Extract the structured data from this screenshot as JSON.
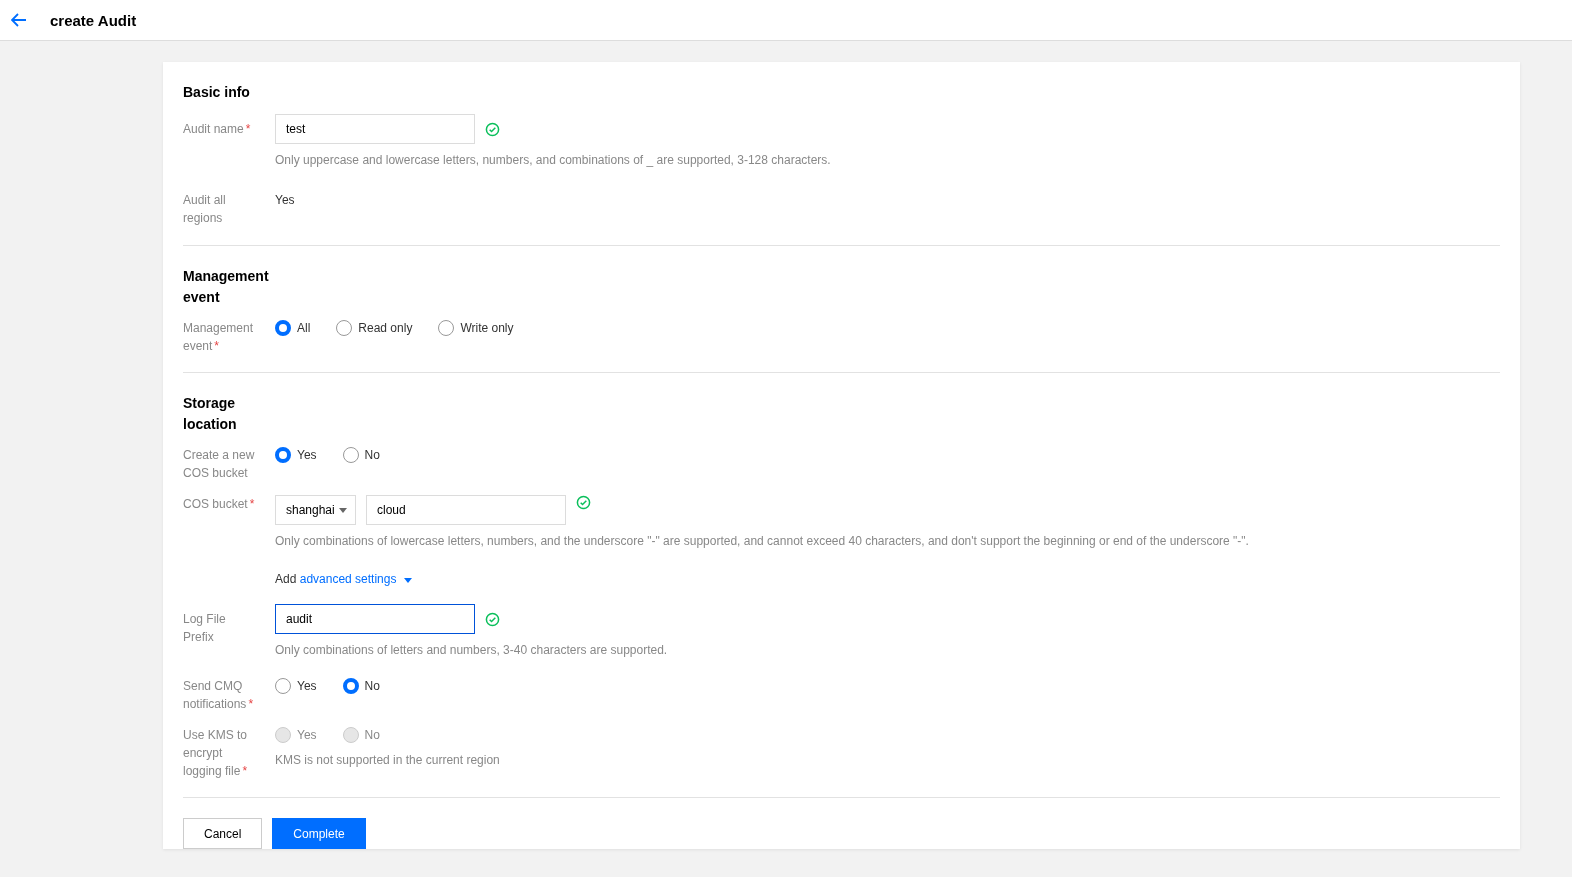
{
  "header": {
    "title": "create Audit"
  },
  "sections": [
    {
      "title": "Basic info",
      "rows": [
        {
          "kind": "input",
          "label": "Audit name",
          "required_mark": "*",
          "value": "test",
          "valid": true,
          "focused": false,
          "hint": "Only uppercase and lowercase letters, numbers, and combinations of _ are supported, 3-128 characters."
        },
        {
          "kind": "text",
          "label": "Audit all regions",
          "value": "Yes"
        }
      ]
    },
    {
      "title": "Management event",
      "rows": [
        {
          "kind": "radio",
          "label": "Management event",
          "required_mark": "*",
          "disabled": false,
          "options": [
            {
              "label": "All",
              "selected": true
            },
            {
              "label": "Read only",
              "selected": false
            },
            {
              "label": "Write only",
              "selected": false
            }
          ]
        }
      ]
    },
    {
      "title": "Storage location",
      "rows": [
        {
          "kind": "radio",
          "label": "Create a new COS bucket",
          "disabled": false,
          "options": [
            {
              "label": "Yes",
              "selected": true
            },
            {
              "label": "No",
              "selected": false
            }
          ]
        },
        {
          "kind": "bucket",
          "label": "COS bucket",
          "required_mark": "*",
          "region": "shanghai",
          "value": "cloud",
          "valid": true,
          "hint": "Only combinations of lowercase letters, numbers, and the underscore \"-\" are supported, and cannot exceed 40 characters, and don't support the beginning or end of the underscore \"-\"."
        },
        {
          "kind": "link",
          "prefix": "Add",
          "link": "advanced settings"
        },
        {
          "kind": "input",
          "label": "Log File Prefix",
          "value": "audit",
          "valid": true,
          "focused": true,
          "hint": "Only combinations of letters and numbers, 3-40 characters are supported."
        },
        {
          "kind": "radio",
          "label": "Send CMQ notifications",
          "required_mark": "*",
          "disabled": false,
          "options": [
            {
              "label": "Yes",
              "selected": false
            },
            {
              "label": "No",
              "selected": true
            }
          ]
        },
        {
          "kind": "radio",
          "label": "Use KMS to encrypt logging file",
          "required_mark": "*",
          "disabled": true,
          "hint": "KMS is not supported in the current region",
          "options": [
            {
              "label": "Yes",
              "selected": false
            },
            {
              "label": "No",
              "selected": false
            }
          ]
        }
      ]
    }
  ],
  "buttons": [
    {
      "label": "Cancel",
      "kind": "secondary"
    },
    {
      "label": "Complete",
      "kind": "primary"
    }
  ]
}
